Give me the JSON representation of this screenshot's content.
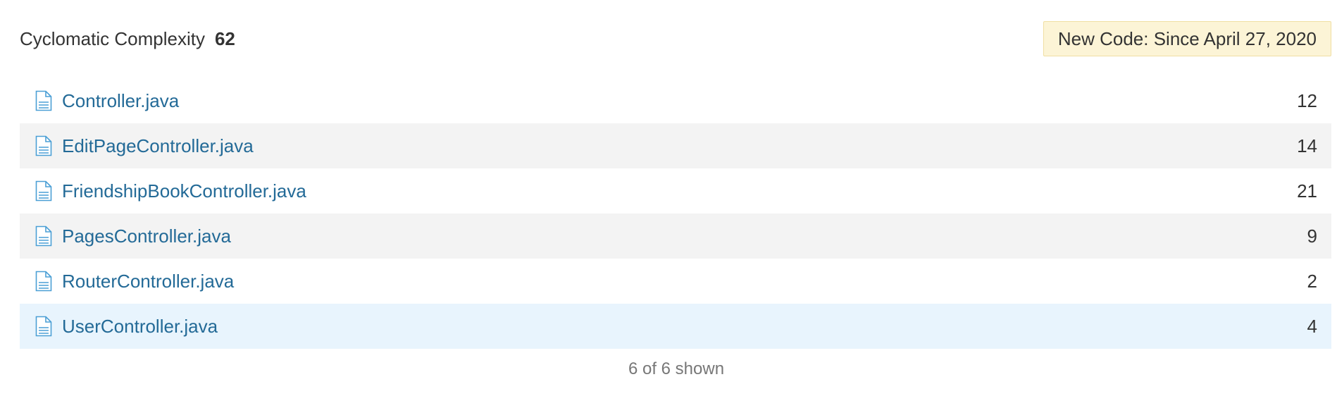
{
  "header": {
    "metric_name": "Cyclomatic Complexity",
    "metric_value": "62",
    "new_code_label": "New Code: Since April 27, 2020"
  },
  "files": [
    {
      "name": "Controller.java",
      "value": "12",
      "icon": "file-icon"
    },
    {
      "name": "EditPageController.java",
      "value": "14",
      "icon": "file-icon"
    },
    {
      "name": "FriendshipBookController.java",
      "value": "21",
      "icon": "file-icon"
    },
    {
      "name": "PagesController.java",
      "value": "9",
      "icon": "file-icon"
    },
    {
      "name": "RouterController.java",
      "value": "2",
      "icon": "file-icon"
    },
    {
      "name": "UserController.java",
      "value": "4",
      "icon": "file-icon"
    }
  ],
  "footer": {
    "count_text": "6 of 6 shown"
  },
  "colors": {
    "link": "#236a97",
    "badge_bg": "#fcf4d6",
    "stripe_bg": "#f3f3f3",
    "selected_bg": "#e8f4fd"
  }
}
